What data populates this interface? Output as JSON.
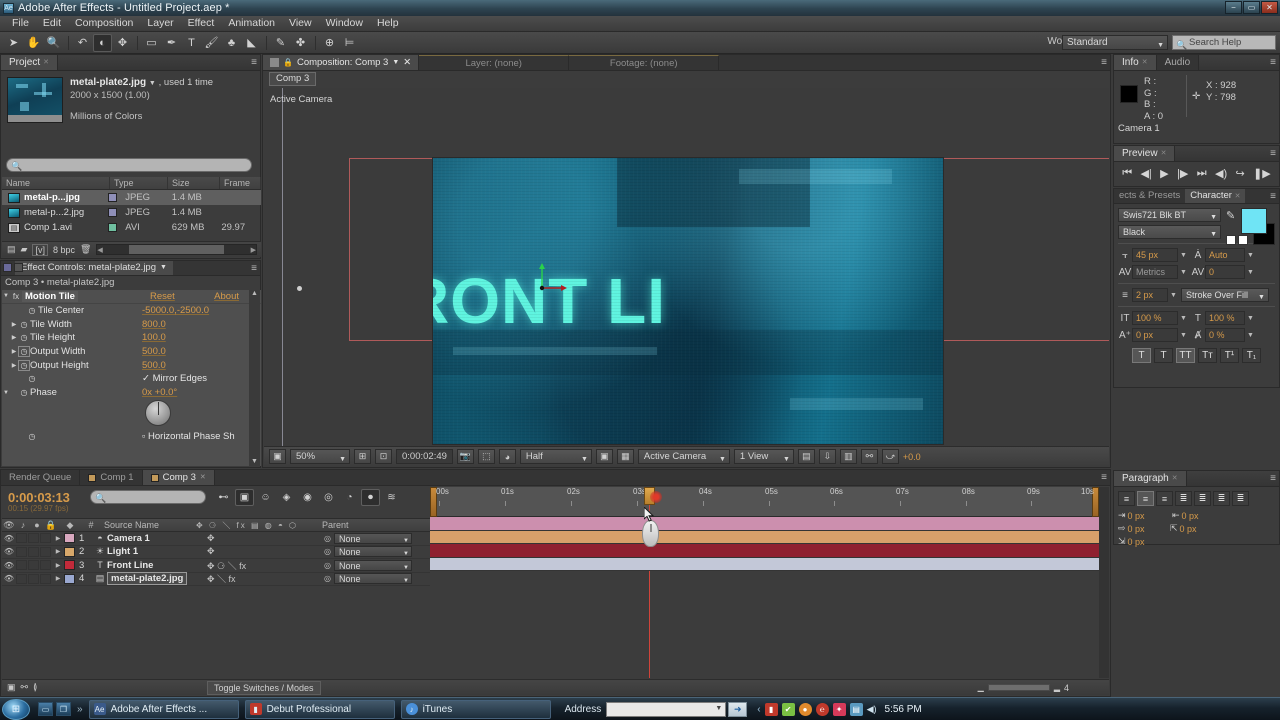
{
  "window": {
    "title": "Adobe After Effects - Untitled Project.aep *",
    "app_icon": "ae-icon",
    "minimize": "−",
    "maximize": "▭",
    "close": "✕"
  },
  "menubar": {
    "items": [
      "File",
      "Edit",
      "Composition",
      "Layer",
      "Effect",
      "Animation",
      "View",
      "Window",
      "Help"
    ]
  },
  "toolbar": {
    "tools": [
      {
        "name": "selection-tool",
        "glyph": "➤"
      },
      {
        "name": "hand-tool",
        "glyph": "✋"
      },
      {
        "name": "zoom-tool",
        "glyph": "🔍"
      },
      {
        "name": "rotation-tool",
        "glyph": "↶"
      },
      {
        "name": "unified-camera-tool",
        "glyph": "◐"
      },
      {
        "name": "pan-behind-tool",
        "glyph": "✥"
      },
      {
        "name": "rectangle-tool",
        "glyph": "▭"
      },
      {
        "name": "pen-tool",
        "glyph": "✒"
      },
      {
        "name": "type-tool",
        "glyph": "T"
      },
      {
        "name": "brush-tool",
        "glyph": "🖌"
      },
      {
        "name": "clone-stamp-tool",
        "glyph": "♣"
      },
      {
        "name": "eraser-tool",
        "glyph": "◣"
      },
      {
        "name": "roto-brush-tool",
        "glyph": "✎"
      },
      {
        "name": "puppet-pin-tool",
        "glyph": "✤"
      }
    ],
    "extra_tools": [
      {
        "name": "snapping-toggle",
        "glyph": "⊕"
      },
      {
        "name": "align-toggle",
        "glyph": "⊨"
      }
    ],
    "workspace_label": "Workspace:",
    "workspace_value": "Standard",
    "search_help_placeholder": "Search Help",
    "search_icon": "search-icon"
  },
  "project_panel": {
    "tab": "Project",
    "asset": {
      "name": "metal-plate2.jpg",
      "used": ", used 1 time",
      "dimensions": "2000 x 1500 (1.00)",
      "color_depth": "Millions of Colors"
    },
    "search_placeholder": "",
    "columns": [
      "Name",
      "Type",
      "Size",
      "Frame R..."
    ],
    "rows": [
      {
        "name": "metal-p...jpg",
        "type": "JPEG",
        "size": "1.4 MB",
        "frame_rate": "",
        "selected": true,
        "swatch": "#8f8fb8",
        "icon": "image-icon"
      },
      {
        "name": "metal-p...2.jpg",
        "type": "JPEG",
        "size": "1.4 MB",
        "frame_rate": "",
        "selected": false,
        "swatch": "#8f8fb8",
        "icon": "image-icon"
      },
      {
        "name": "Comp 1.avi",
        "type": "AVI",
        "size": "629 MB",
        "frame_rate": "29.97",
        "selected": false,
        "swatch": "#6fbfa0",
        "icon": "video-icon"
      }
    ],
    "footer": {
      "new_comp_icon": "new-composition-icon",
      "new_folder_icon": "new-folder-icon",
      "bit_depth_icon": "[v]",
      "bit_depth": "8 bpc",
      "delete_icon": "trash-icon"
    }
  },
  "effect_controls": {
    "tab": "Effect Controls: metal-plate2.jpg",
    "breadcrumb": "Comp 3 • metal-plate2.jpg",
    "effect_name": "Motion Tile",
    "header_left_value": "Reset",
    "header_right_value": "About",
    "properties": [
      {
        "label": "Tile Center",
        "value": "-5000.0,-2500.0",
        "has_twirl": false,
        "has_stopwatch": true,
        "keyed": false,
        "position_icon": true
      },
      {
        "label": "Tile Width",
        "value": "800.0",
        "has_twirl": true,
        "has_stopwatch": true,
        "keyed": false
      },
      {
        "label": "Tile Height",
        "value": "100.0",
        "has_twirl": true,
        "has_stopwatch": true,
        "keyed": false
      },
      {
        "label": "Output Width",
        "value": "500.0",
        "has_twirl": true,
        "has_stopwatch": true,
        "keyed": true
      },
      {
        "label": "Output Height",
        "value": "500.0",
        "has_twirl": true,
        "has_stopwatch": true,
        "keyed": true
      },
      {
        "label": "",
        "value": "",
        "checkbox": true,
        "checkbox_label": "Mirror Edges",
        "checked": true
      },
      {
        "label": "Phase",
        "value": "0x +0.0°",
        "has_twirl": true,
        "has_stopwatch": true,
        "keyed": false
      },
      {
        "label": "",
        "value": "",
        "checkbox": true,
        "checkbox_label": "Horizontal Phase Sh",
        "checked": false
      }
    ]
  },
  "composition_viewer": {
    "tabs": [
      {
        "label": "Composition: Comp 3",
        "active": true,
        "has_dropdown": true
      },
      {
        "label": "Layer: (none)",
        "active": false,
        "has_dropdown": false
      },
      {
        "label": "Footage: (none)",
        "active": false,
        "has_dropdown": false
      }
    ],
    "breadcrumb": "Comp 3",
    "view_label": "Active Camera",
    "stage_text": "RONT LI",
    "toolbar": {
      "magnification": "50%",
      "current_time": "0:00:02:49",
      "resolution": "Half",
      "view_camera": "Active Camera",
      "view_layout": "1 View",
      "exposure": "+0.0",
      "icons": [
        "always-preview-icon",
        "region-of-interest-icon",
        "title-action-safe-icon",
        "take-snapshot-icon",
        "show-snapshot-icon",
        "channel-icon",
        "toggle-mask-icon",
        "transparency-grid-icon",
        "timeline-icon",
        "comp-flowchart-icon",
        "exposure-reset-icon"
      ]
    }
  },
  "info_panel": {
    "tabs": [
      {
        "label": "Info",
        "active": true
      },
      {
        "label": "Audio",
        "active": false
      }
    ],
    "channels": [
      "R :",
      "G :",
      "B :",
      "A : 0"
    ],
    "x_label": "X : 928",
    "y_label": "Y : 798",
    "camera": "Camera 1",
    "crosshair_icon": "crosshair-icon"
  },
  "preview_panel": {
    "tab": "Preview",
    "buttons": [
      {
        "name": "first-frame-button",
        "glyph": "⏮"
      },
      {
        "name": "previous-frame-button",
        "glyph": "◀|"
      },
      {
        "name": "play-button",
        "glyph": "▶"
      },
      {
        "name": "next-frame-button",
        "glyph": "|▶"
      },
      {
        "name": "last-frame-button",
        "glyph": "⏭"
      },
      {
        "name": "audio-button",
        "glyph": "◀)"
      },
      {
        "name": "loop-button",
        "glyph": "↪"
      },
      {
        "name": "ram-preview-button",
        "glyph": "❚▶"
      }
    ]
  },
  "character_panel": {
    "tabs": [
      {
        "label": "ects & Presets",
        "active": false
      },
      {
        "label": "Character",
        "active": true
      }
    ],
    "font_family": "Swis721 Blk BT",
    "font_style": "Black",
    "fill_color": "#6fe4f5",
    "stroke_color": "#000000",
    "font_size": "45 px",
    "leading": "Auto",
    "kerning": "Metrics",
    "tracking": "0",
    "stroke_width": "2 px",
    "stroke_mode": "Stroke Over Fill",
    "vertical_scale": "100 %",
    "horizontal_scale": "100 %",
    "baseline_shift": "0 px",
    "tsume": "0 %",
    "style_buttons": [
      {
        "name": "faux-bold-button",
        "glyph": "T",
        "on": true
      },
      {
        "name": "faux-italic-button",
        "glyph": "T",
        "on": false
      },
      {
        "name": "all-caps-button",
        "glyph": "TT",
        "on": true
      },
      {
        "name": "small-caps-button",
        "glyph": "Tᴛ",
        "on": false
      },
      {
        "name": "superscript-button",
        "glyph": "T¹",
        "on": false
      },
      {
        "name": "subscript-button",
        "glyph": "T₁",
        "on": false
      }
    ],
    "eyedropper_icon": "eyedropper-icon"
  },
  "paragraph_panel": {
    "tab": "Paragraph",
    "align_buttons": [
      {
        "name": "align-left-button",
        "glyph": "≡",
        "on": false
      },
      {
        "name": "align-center-button",
        "glyph": "≡",
        "on": true
      },
      {
        "name": "align-right-button",
        "glyph": "≡",
        "on": false
      },
      {
        "name": "justify-last-left-button",
        "glyph": "≣",
        "on": false
      },
      {
        "name": "justify-last-center-button",
        "glyph": "≣",
        "on": false
      },
      {
        "name": "justify-last-right-button",
        "glyph": "≣",
        "on": false
      },
      {
        "name": "justify-all-button",
        "glyph": "≣",
        "on": false
      }
    ],
    "indent_left": "0 px",
    "indent_right": "0 px",
    "indent_first": "0 px",
    "space_before": "0 px",
    "space_after": "0 px"
  },
  "timeline": {
    "tabs": [
      {
        "label": "Render Queue",
        "active": false,
        "has_chip": false
      },
      {
        "label": "Comp 1",
        "active": false,
        "has_chip": true,
        "chip": "#c39a5a"
      },
      {
        "label": "Comp 3",
        "active": true,
        "has_chip": true,
        "chip": "#c39a5a"
      }
    ],
    "current_time": "0:00:03:13",
    "fps_note": "00:15 (29.97 fps)",
    "search_placeholder": "",
    "switch_buttons": [
      {
        "name": "composition-mini-flowchart-button",
        "glyph": "⊷",
        "on": false
      },
      {
        "name": "draft-3d-button",
        "glyph": "▣",
        "on": true
      },
      {
        "name": "hide-shy-layers-button",
        "glyph": "☺",
        "on": false
      },
      {
        "name": "frame-blending-button",
        "glyph": "◈",
        "on": false
      },
      {
        "name": "motion-blur-button",
        "glyph": "◉",
        "on": false
      },
      {
        "name": "brainstorm-button",
        "glyph": "◎",
        "on": false
      },
      {
        "name": "graph-editor-button",
        "glyph": "◔",
        "on": false
      },
      {
        "name": "auto-keyframe-button",
        "glyph": "⏺",
        "on": true
      },
      {
        "name": "motion-sketch-button",
        "glyph": "≋",
        "on": false
      }
    ],
    "columns": [
      "Source Name",
      "Parent"
    ],
    "layer_switch_icons": [
      "audio-icon",
      "solo-icon",
      "lock-icon"
    ],
    "column_icons": [
      "shy-icon",
      "collapse-icon",
      "quality-icon",
      "effects-icon",
      "frame-blend-icon",
      "motion-blur-icon",
      "adjustment-icon",
      "3d-layer-icon"
    ],
    "layers": [
      {
        "index": "1",
        "name": "Camera 1",
        "type_icon": "camera-icon",
        "chip": "#d9a8bf",
        "parent": "None",
        "selected": false,
        "bar_color": "#cc8fae"
      },
      {
        "index": "2",
        "name": "Light 1",
        "type_icon": "light-icon",
        "chip": "#d8a86a",
        "parent": "None",
        "selected": false,
        "bar_color": "#d7a06a"
      },
      {
        "index": "3",
        "name": "Front Line",
        "type_icon": "text-icon",
        "chip": "#c22a3a",
        "parent": "None",
        "selected": false,
        "bar_color": "#8f2030"
      },
      {
        "index": "4",
        "name": "metal-plate2.jpg",
        "type_icon": "image-icon",
        "chip": "#9aa8d0",
        "parent": "None",
        "selected": true,
        "bar_color": "#c3c8d8"
      }
    ],
    "ruler_ticks": [
      "00s",
      "01s",
      "02s",
      "03s",
      "04s",
      "05s",
      "06s",
      "07s",
      "08s",
      "09s",
      "10s"
    ],
    "toggle_switches_label": "Toggle Switches / Modes",
    "footer_icons": [
      "toggle-switches-icon",
      "comp-flowchart-icon",
      "motion-blur-footer-icon"
    ],
    "zoom_value": "4"
  },
  "taskbar": {
    "start_glyph": "⊞",
    "quick_launch": [
      {
        "name": "show-desktop-icon",
        "glyph": "▭"
      },
      {
        "name": "switch-windows-icon",
        "glyph": "❐"
      }
    ],
    "overflow_glyph": "»",
    "tasks": [
      {
        "label": "Adobe After Effects ...",
        "icon_text": "Ae",
        "icon_color": "#3a5a8a",
        "active": true
      },
      {
        "label": "Debut Professional",
        "icon_text": "▮",
        "icon_color": "#c0392b",
        "active": false
      },
      {
        "label": "iTunes",
        "icon_text": "♪",
        "icon_color": "#4a90d9",
        "active": false
      }
    ],
    "address_label": "Address",
    "address_value": "",
    "go_glyph": "➜",
    "tray_icons": [
      {
        "name": "tray-expand-icon",
        "glyph": "‹",
        "color": "#9ec4dc"
      },
      {
        "name": "tray-app1-icon",
        "glyph": "▮",
        "color": "#c0392b"
      },
      {
        "name": "tray-app2-icon",
        "glyph": "✔",
        "color": "#7ac043"
      },
      {
        "name": "tray-app3-icon",
        "glyph": "●",
        "color": "#e08a2c"
      },
      {
        "name": "tray-app4-icon",
        "glyph": "℮",
        "color": "#c0392b"
      },
      {
        "name": "tray-app5-icon",
        "glyph": "✦",
        "color": "#d63a5a"
      },
      {
        "name": "tray-network-icon",
        "glyph": "▤",
        "color": "#5a9ac0"
      },
      {
        "name": "tray-volume-icon",
        "glyph": "◀)",
        "color": "#cfe3ef"
      }
    ],
    "clock": "5:56 PM"
  }
}
